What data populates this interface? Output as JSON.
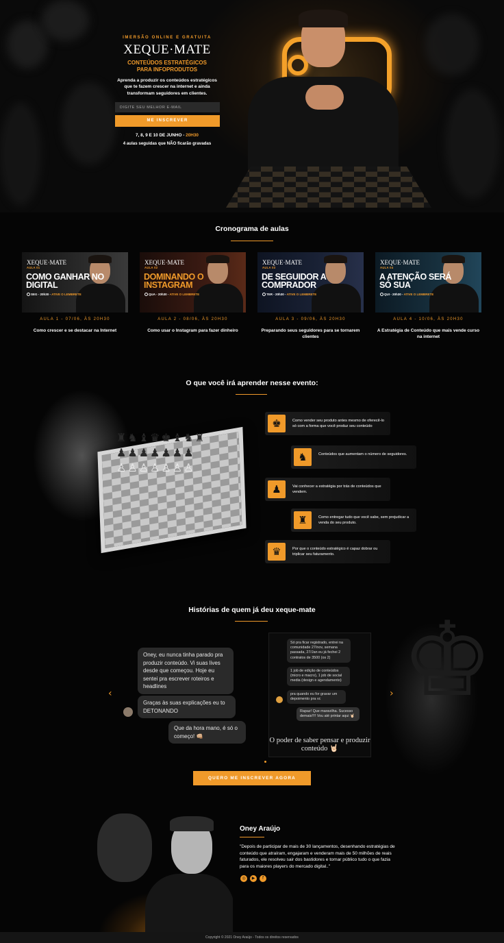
{
  "hero": {
    "kicker": "IMERSÃO ONLINE E GRATUITA",
    "logo": "XEQUE·MATE",
    "subtitle_line1": "CONTEÚDOS ESTRATÉGICOS",
    "subtitle_line2": "PARA INFOPRODUTOS",
    "lede": "Aprenda a produzir os conteúdos estratégicos que te fazem crescer na internet e ainda transformam seguidores em clientes.",
    "email_placeholder": "DIGITE SEU MELHOR E-MAIL",
    "cta": "ME INSCREVER",
    "dates": "7, 8, 9 E 10 DE JUNHO - ",
    "time": "20H30",
    "note": "4 aulas seguidas que NÃO ficarão gravadas"
  },
  "schedule": {
    "title": "Cronograma de aulas",
    "cards": [
      {
        "logo": "XEQUE·MATE",
        "aula": "AULA 01",
        "title": "COMO GANHAR NO DIGITAL",
        "when": "SEG - 20h30 - ",
        "reminder": "ATIVE O LEMBRETE",
        "date": "AULA 1 - 07/06, ÀS 20H30",
        "desc": "Como crescer e se destacar na Internet",
        "accent": "#ffffff"
      },
      {
        "logo": "XEQUE·MATE",
        "aula": "AULA 02",
        "title": "DOMINANDO O INSTAGRAM",
        "when": "QUA - 20h30 - ",
        "reminder": "ATIVE O LEMBRETE",
        "date": "AULA 2 - 08/06, ÀS 20H30",
        "desc": "Como usar o Instagram para fazer dinheiro",
        "accent": "#f09a2a"
      },
      {
        "logo": "XEQUE·MATE",
        "aula": "AULA 03",
        "title": "DE SEGUIDOR A COMPRADOR",
        "when": "TER - 20h30 - ",
        "reminder": "ATIVE O LEMBRETE",
        "date": "AULA 3 - 09/06, ÀS 20H30",
        "desc": "Preparando seus seguidores para se tornarem clientes",
        "accent": "#ffffff"
      },
      {
        "logo": "XEQUE·MATE",
        "aula": "AULA 04",
        "title": "A ATENÇÃO SERÁ SÓ SUA",
        "when": "QUI - 20h30 - ",
        "reminder": "ATIVE O LEMBRETE",
        "date": "AULA 4 - 10/06, ÀS 20H30",
        "desc": "A Estratégia de Conteúdo que mais vende curso na internet",
        "accent": "#ffffff"
      }
    ]
  },
  "learn": {
    "title": "O que você irá aprender nesse evento:",
    "items": [
      {
        "icon": "♚",
        "icon_name": "king-icon",
        "text": "Como vender seu produto antes mesmo de oferecê-lo só com a forma que você produz seu conteúdo"
      },
      {
        "icon": "♞",
        "icon_name": "knight-icon",
        "text": "Conteúdos que aumentam o número de seguidores."
      },
      {
        "icon": "♟",
        "icon_name": "pawn-icon",
        "text": "Vai conhecer a estratégia por trás de conteúdos que vendem."
      },
      {
        "icon": "♜",
        "icon_name": "rook-icon",
        "text": "Como entregar tudo que você sabe, sem prejudicar a venda do seu produto."
      },
      {
        "icon": "♛",
        "icon_name": "queen-icon",
        "text": "Por que o conteúdo estratégico é capaz dobrar ou triplicar seu faturamento."
      }
    ]
  },
  "stories": {
    "title": "Histórias de quem já deu xeque-mate",
    "bubble1": "Oney, eu nunca tinha parado pra produzir conteúdo. Vi suas lives desde que começou. Hoje eu sentei pra escrever roteiros e headlines",
    "bubble2": "Graças às suas explicações eu to DETONANDO",
    "bubble3": "Que da hora mano, é só o começo! 👊🏼",
    "chat1": "Só pra ficar registrado, entrei na comunidade 27/nov, semana passada, 27/Jan eu já fechei 2 contratos de 3500 (os 2)",
    "chat2": "1 job de edição de conteúdos (micro e macro), 1 job de social media (design e agendamento)",
    "chat3": "pra quando eu for gravar um depoimento pra vc",
    "chat4": "Rapaz! Que maravilha. Sucesso demais!!!! Vou até printar aqui 🤘🏻",
    "quote": "O poder de saber pensar e produzir conteúdo 🤘🏻",
    "prev": "‹",
    "next": "›",
    "cta": "QUERO ME INSCREVER AGORA"
  },
  "bio": {
    "name": "Oney Araújo",
    "text": "\"Depois de participar de mais de 30 lançamentos, desenhando estratégias de conteúdo que atraíram, engajaram e venderam mais de 50 milhões de reais faturados, ele resolveu sair dos bastidores e tornar público tudo o que fazia para os maiores players do mercado digital..\"",
    "social": [
      {
        "icon": "◎",
        "name": "instagram-icon"
      },
      {
        "icon": "▶",
        "name": "youtube-icon"
      },
      {
        "icon": "f",
        "name": "facebook-icon"
      }
    ]
  },
  "footer": "Copyright © 2021 Oney Araújo - Todos os direitos reservados",
  "colors": {
    "accent": "#f09a2a",
    "background": "#050505"
  }
}
